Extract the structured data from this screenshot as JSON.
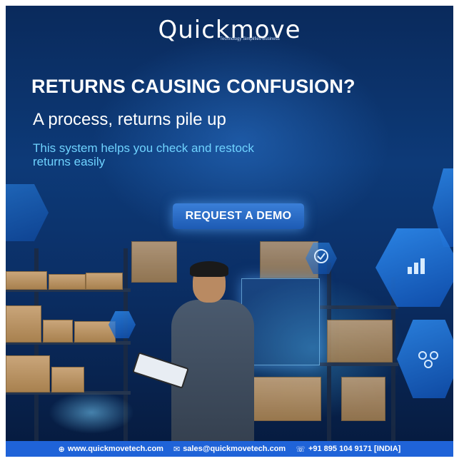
{
  "brand": {
    "name": "Quickmove",
    "tagline": "Technology Simplifies Business"
  },
  "headline": "RETURNS CAUSING CONFUSION?",
  "subheadline": "A process, returns pile up",
  "description": "This system helps you check and restock returns easily",
  "cta_label": "REQUEST A DEMO",
  "footer": {
    "website": "www.quickmovetech.com",
    "email": "sales@quickmovetech.com",
    "phone": "+91 895 104 9171 [INDIA]"
  },
  "icons": {
    "website": "globe-icon",
    "email": "envelope-icon",
    "phone": "phone-icon",
    "hex_bar_chart": "bar-chart-icon",
    "hex_check": "check-shield-icon",
    "hex_network": "network-icon"
  },
  "colors": {
    "background_top": "#0a2a5c",
    "accent_cyan": "#6fd3ff",
    "cta": "#1d5bb4",
    "footer_bar": "#1f63d8"
  }
}
